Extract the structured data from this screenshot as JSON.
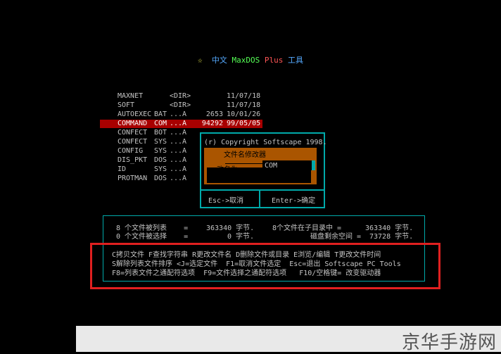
{
  "title": {
    "star": "☆",
    "zw": "中文",
    "maxdos": "MaxDOS",
    "plus": "Plus",
    "tool": "工具"
  },
  "files": [
    {
      "name": "MAXNET",
      "ext": "",
      "attr": "<DIR>",
      "size": "",
      "date": "11/07/18"
    },
    {
      "name": "SOFT",
      "ext": "",
      "attr": "<DIR>",
      "size": "",
      "date": "11/07/18"
    },
    {
      "name": "AUTOEXEC",
      "ext": "BAT",
      "attr": "...A",
      "size": "2653",
      "date": "10/01/26"
    },
    {
      "name": "COMMAND",
      "ext": "COM",
      "attr": "...A",
      "size": "94292",
      "date": "99/05/05"
    },
    {
      "name": "CONFECT",
      "ext": "BOT",
      "attr": "...A",
      "size": "",
      "date": ""
    },
    {
      "name": "CONFECT",
      "ext": "SYS",
      "attr": "...A",
      "size": "",
      "date": ""
    },
    {
      "name": "CONFIG",
      "ext": "SYS",
      "attr": "...A",
      "size": "",
      "date": ""
    },
    {
      "name": "DIS_PKT",
      "ext": "DOS",
      "attr": "...A",
      "size": "",
      "date": ""
    },
    {
      "name": "ID",
      "ext": "SYS",
      "attr": "...A",
      "size": "",
      "date": ""
    },
    {
      "name": "PROTMAN",
      "ext": "DOS",
      "attr": "...A",
      "size": "",
      "date": ""
    }
  ],
  "selected_index": 3,
  "dialog": {
    "copyright": "(r) Copyright Softscape 1998.",
    "title": "文件名修改器",
    "rename_label": "改名为   :",
    "input_value": "COM",
    "esc": "Esc->取消",
    "enter": "Enter->确定"
  },
  "stats": {
    "listed_label": "8 个文件被列表    =",
    "listed_bytes": "363340 字节.",
    "selected_label": "0 个文件被选择    =",
    "selected_bytes": "0 字节.",
    "in_dir_label": "8个文件在子目录中 =",
    "in_dir_bytes": "363340 字节.",
    "free_label": "磁盘剩余空间 =",
    "free_bytes": "73728 字节."
  },
  "help": {
    "line1": "C拷贝文件 F查找字符串 R更改文件名 D删除文件或目录 E浏览/编辑 T更改文件时间",
    "line2": "S解除列表文件排序 <J=选定文件  F1=取消文件选定  Esc=退出 Softscape PC Tools",
    "line3": "F8=列表文件之通配符选项  F9=文件选择之通配符选项   F10/空格键= 改变驱动器"
  },
  "watermark": "京华手游网",
  "colors": {
    "background": "#000000",
    "selection": "#a80000",
    "dialog_fill": "#aa5500",
    "border_cyan": "#00aaaa",
    "highlight_red": "#e02020"
  }
}
